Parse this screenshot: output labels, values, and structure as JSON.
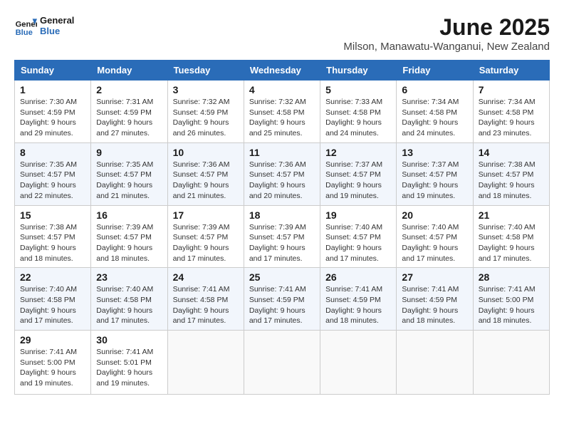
{
  "header": {
    "logo_text_general": "General",
    "logo_text_blue": "Blue",
    "title": "June 2025",
    "subtitle": "Milson, Manawatu-Wanganui, New Zealand"
  },
  "calendar": {
    "days_of_week": [
      "Sunday",
      "Monday",
      "Tuesday",
      "Wednesday",
      "Thursday",
      "Friday",
      "Saturday"
    ],
    "weeks": [
      [
        null,
        null,
        null,
        null,
        null,
        null,
        null,
        {
          "day": "1",
          "sunrise": "Sunrise: 7:30 AM",
          "sunset": "Sunset: 4:59 PM",
          "daylight": "Daylight: 9 hours and 29 minutes."
        },
        {
          "day": "2",
          "sunrise": "Sunrise: 7:31 AM",
          "sunset": "Sunset: 4:59 PM",
          "daylight": "Daylight: 9 hours and 27 minutes."
        },
        {
          "day": "3",
          "sunrise": "Sunrise: 7:32 AM",
          "sunset": "Sunset: 4:59 PM",
          "daylight": "Daylight: 9 hours and 26 minutes."
        },
        {
          "day": "4",
          "sunrise": "Sunrise: 7:32 AM",
          "sunset": "Sunset: 4:58 PM",
          "daylight": "Daylight: 9 hours and 25 minutes."
        },
        {
          "day": "5",
          "sunrise": "Sunrise: 7:33 AM",
          "sunset": "Sunset: 4:58 PM",
          "daylight": "Daylight: 9 hours and 24 minutes."
        },
        {
          "day": "6",
          "sunrise": "Sunrise: 7:34 AM",
          "sunset": "Sunset: 4:58 PM",
          "daylight": "Daylight: 9 hours and 24 minutes."
        },
        {
          "day": "7",
          "sunrise": "Sunrise: 7:34 AM",
          "sunset": "Sunset: 4:58 PM",
          "daylight": "Daylight: 9 hours and 23 minutes."
        }
      ],
      [
        {
          "day": "8",
          "sunrise": "Sunrise: 7:35 AM",
          "sunset": "Sunset: 4:57 PM",
          "daylight": "Daylight: 9 hours and 22 minutes."
        },
        {
          "day": "9",
          "sunrise": "Sunrise: 7:35 AM",
          "sunset": "Sunset: 4:57 PM",
          "daylight": "Daylight: 9 hours and 21 minutes."
        },
        {
          "day": "10",
          "sunrise": "Sunrise: 7:36 AM",
          "sunset": "Sunset: 4:57 PM",
          "daylight": "Daylight: 9 hours and 21 minutes."
        },
        {
          "day": "11",
          "sunrise": "Sunrise: 7:36 AM",
          "sunset": "Sunset: 4:57 PM",
          "daylight": "Daylight: 9 hours and 20 minutes."
        },
        {
          "day": "12",
          "sunrise": "Sunrise: 7:37 AM",
          "sunset": "Sunset: 4:57 PM",
          "daylight": "Daylight: 9 hours and 19 minutes."
        },
        {
          "day": "13",
          "sunrise": "Sunrise: 7:37 AM",
          "sunset": "Sunset: 4:57 PM",
          "daylight": "Daylight: 9 hours and 19 minutes."
        },
        {
          "day": "14",
          "sunrise": "Sunrise: 7:38 AM",
          "sunset": "Sunset: 4:57 PM",
          "daylight": "Daylight: 9 hours and 18 minutes."
        }
      ],
      [
        {
          "day": "15",
          "sunrise": "Sunrise: 7:38 AM",
          "sunset": "Sunset: 4:57 PM",
          "daylight": "Daylight: 9 hours and 18 minutes."
        },
        {
          "day": "16",
          "sunrise": "Sunrise: 7:39 AM",
          "sunset": "Sunset: 4:57 PM",
          "daylight": "Daylight: 9 hours and 18 minutes."
        },
        {
          "day": "17",
          "sunrise": "Sunrise: 7:39 AM",
          "sunset": "Sunset: 4:57 PM",
          "daylight": "Daylight: 9 hours and 17 minutes."
        },
        {
          "day": "18",
          "sunrise": "Sunrise: 7:39 AM",
          "sunset": "Sunset: 4:57 PM",
          "daylight": "Daylight: 9 hours and 17 minutes."
        },
        {
          "day": "19",
          "sunrise": "Sunrise: 7:40 AM",
          "sunset": "Sunset: 4:57 PM",
          "daylight": "Daylight: 9 hours and 17 minutes."
        },
        {
          "day": "20",
          "sunrise": "Sunrise: 7:40 AM",
          "sunset": "Sunset: 4:57 PM",
          "daylight": "Daylight: 9 hours and 17 minutes."
        },
        {
          "day": "21",
          "sunrise": "Sunrise: 7:40 AM",
          "sunset": "Sunset: 4:58 PM",
          "daylight": "Daylight: 9 hours and 17 minutes."
        }
      ],
      [
        {
          "day": "22",
          "sunrise": "Sunrise: 7:40 AM",
          "sunset": "Sunset: 4:58 PM",
          "daylight": "Daylight: 9 hours and 17 minutes."
        },
        {
          "day": "23",
          "sunrise": "Sunrise: 7:40 AM",
          "sunset": "Sunset: 4:58 PM",
          "daylight": "Daylight: 9 hours and 17 minutes."
        },
        {
          "day": "24",
          "sunrise": "Sunrise: 7:41 AM",
          "sunset": "Sunset: 4:58 PM",
          "daylight": "Daylight: 9 hours and 17 minutes."
        },
        {
          "day": "25",
          "sunrise": "Sunrise: 7:41 AM",
          "sunset": "Sunset: 4:59 PM",
          "daylight": "Daylight: 9 hours and 17 minutes."
        },
        {
          "day": "26",
          "sunrise": "Sunrise: 7:41 AM",
          "sunset": "Sunset: 4:59 PM",
          "daylight": "Daylight: 9 hours and 18 minutes."
        },
        {
          "day": "27",
          "sunrise": "Sunrise: 7:41 AM",
          "sunset": "Sunset: 4:59 PM",
          "daylight": "Daylight: 9 hours and 18 minutes."
        },
        {
          "day": "28",
          "sunrise": "Sunrise: 7:41 AM",
          "sunset": "Sunset: 5:00 PM",
          "daylight": "Daylight: 9 hours and 18 minutes."
        }
      ],
      [
        {
          "day": "29",
          "sunrise": "Sunrise: 7:41 AM",
          "sunset": "Sunset: 5:00 PM",
          "daylight": "Daylight: 9 hours and 19 minutes."
        },
        {
          "day": "30",
          "sunrise": "Sunrise: 7:41 AM",
          "sunset": "Sunset: 5:01 PM",
          "daylight": "Daylight: 9 hours and 19 minutes."
        },
        null,
        null,
        null,
        null,
        null
      ]
    ]
  }
}
